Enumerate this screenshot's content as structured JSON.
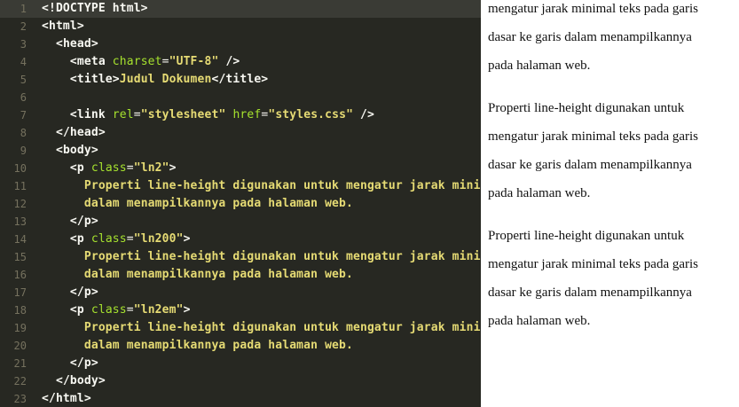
{
  "editor": {
    "lines": [
      {
        "n": "1",
        "active": true,
        "tokens": [
          {
            "t": "tag",
            "v": "<!DOCTYPE html>"
          }
        ]
      },
      {
        "n": "2",
        "tokens": [
          {
            "t": "tag",
            "v": "<html>"
          }
        ]
      },
      {
        "n": "3",
        "tokens": [
          {
            "t": "ws",
            "v": "  "
          },
          {
            "t": "tag",
            "v": "<head>"
          }
        ]
      },
      {
        "n": "4",
        "tokens": [
          {
            "t": "ws",
            "v": "    "
          },
          {
            "t": "tag",
            "v": "<meta "
          },
          {
            "t": "attr",
            "v": "charset"
          },
          {
            "t": "eq",
            "v": "="
          },
          {
            "t": "str",
            "v": "\"UTF-8\""
          },
          {
            "t": "tag",
            "v": " />"
          }
        ]
      },
      {
        "n": "5",
        "tokens": [
          {
            "t": "ws",
            "v": "    "
          },
          {
            "t": "tag",
            "v": "<title>"
          },
          {
            "t": "text",
            "v": "Judul Dokumen"
          },
          {
            "t": "tag",
            "v": "</title>"
          }
        ]
      },
      {
        "n": "6",
        "tokens": []
      },
      {
        "n": "7",
        "tokens": [
          {
            "t": "ws",
            "v": "    "
          },
          {
            "t": "tag",
            "v": "<link "
          },
          {
            "t": "attr",
            "v": "rel"
          },
          {
            "t": "eq",
            "v": "="
          },
          {
            "t": "str",
            "v": "\"stylesheet\""
          },
          {
            "t": "tag",
            "v": " "
          },
          {
            "t": "attr",
            "v": "href"
          },
          {
            "t": "eq",
            "v": "="
          },
          {
            "t": "str",
            "v": "\"styles.css\""
          },
          {
            "t": "tag",
            "v": " />"
          }
        ]
      },
      {
        "n": "8",
        "tokens": [
          {
            "t": "ws",
            "v": "  "
          },
          {
            "t": "tag",
            "v": "</head>"
          }
        ]
      },
      {
        "n": "9",
        "tokens": [
          {
            "t": "ws",
            "v": "  "
          },
          {
            "t": "tag",
            "v": "<body>"
          }
        ]
      },
      {
        "n": "10",
        "tokens": [
          {
            "t": "ws",
            "v": "    "
          },
          {
            "t": "tag",
            "v": "<p "
          },
          {
            "t": "attr",
            "v": "class"
          },
          {
            "t": "eq",
            "v": "="
          },
          {
            "t": "str",
            "v": "\"ln2\""
          },
          {
            "t": "tag",
            "v": ">"
          }
        ]
      },
      {
        "n": "11",
        "tokens": [
          {
            "t": "ws",
            "v": "      "
          },
          {
            "t": "text",
            "v": "Properti line-height digunakan untuk mengatur jarak minimal teks pada garis dasar ke garis"
          }
        ]
      },
      {
        "n": "12",
        "tokens": [
          {
            "t": "ws",
            "v": "      "
          },
          {
            "t": "text",
            "v": "dalam menampilkannya pada halaman web."
          }
        ]
      },
      {
        "n": "13",
        "tokens": [
          {
            "t": "ws",
            "v": "    "
          },
          {
            "t": "tag",
            "v": "</p>"
          }
        ]
      },
      {
        "n": "14",
        "tokens": [
          {
            "t": "ws",
            "v": "    "
          },
          {
            "t": "tag",
            "v": "<p "
          },
          {
            "t": "attr",
            "v": "class"
          },
          {
            "t": "eq",
            "v": "="
          },
          {
            "t": "str",
            "v": "\"ln200\""
          },
          {
            "t": "tag",
            "v": ">"
          }
        ]
      },
      {
        "n": "15",
        "tokens": [
          {
            "t": "ws",
            "v": "      "
          },
          {
            "t": "text",
            "v": "Properti line-height digunakan untuk mengatur jarak minimal teks pada garis dasar ke garis"
          }
        ]
      },
      {
        "n": "16",
        "tokens": [
          {
            "t": "ws",
            "v": "      "
          },
          {
            "t": "text",
            "v": "dalam menampilkannya pada halaman web."
          }
        ]
      },
      {
        "n": "17",
        "tokens": [
          {
            "t": "ws",
            "v": "    "
          },
          {
            "t": "tag",
            "v": "</p>"
          }
        ]
      },
      {
        "n": "18",
        "tokens": [
          {
            "t": "ws",
            "v": "    "
          },
          {
            "t": "tag",
            "v": "<p "
          },
          {
            "t": "attr",
            "v": "class"
          },
          {
            "t": "eq",
            "v": "="
          },
          {
            "t": "str",
            "v": "\"ln2em\""
          },
          {
            "t": "tag",
            "v": ">"
          }
        ]
      },
      {
        "n": "19",
        "tokens": [
          {
            "t": "ws",
            "v": "      "
          },
          {
            "t": "text",
            "v": "Properti line-height digunakan untuk mengatur jarak minimal teks pada garis dasar ke garis"
          }
        ]
      },
      {
        "n": "20",
        "tokens": [
          {
            "t": "ws",
            "v": "      "
          },
          {
            "t": "text",
            "v": "dalam menampilkannya pada halaman web."
          }
        ]
      },
      {
        "n": "21",
        "tokens": [
          {
            "t": "ws",
            "v": "    "
          },
          {
            "t": "tag",
            "v": "</p>"
          }
        ]
      },
      {
        "n": "22",
        "tokens": [
          {
            "t": "ws",
            "v": "  "
          },
          {
            "t": "tag",
            "v": "</body>"
          }
        ]
      },
      {
        "n": "23",
        "tokens": [
          {
            "t": "tag",
            "v": "</html>"
          }
        ]
      }
    ]
  },
  "preview": {
    "lines": [
      "mengatur jarak minimal teks pada garis",
      "dasar ke garis dalam menampilkannya",
      "pada halaman web.",
      "",
      "Properti line-height digunakan untuk",
      "mengatur jarak minimal teks pada garis",
      "dasar ke garis dalam menampilkannya",
      "pada halaman web.",
      "",
      "Properti line-height digunakan untuk",
      "mengatur jarak minimal teks pada garis",
      "dasar ke garis dalam menampilkannya",
      "pada halaman web."
    ]
  },
  "colors": {
    "editor_bg": "#272822",
    "active_line": "#3a3b35",
    "gutter": "#75715e",
    "tag": "#f8f8f2",
    "attribute": "#a6e22e",
    "string": "#e6db74",
    "preview_bg": "#ffffff"
  }
}
